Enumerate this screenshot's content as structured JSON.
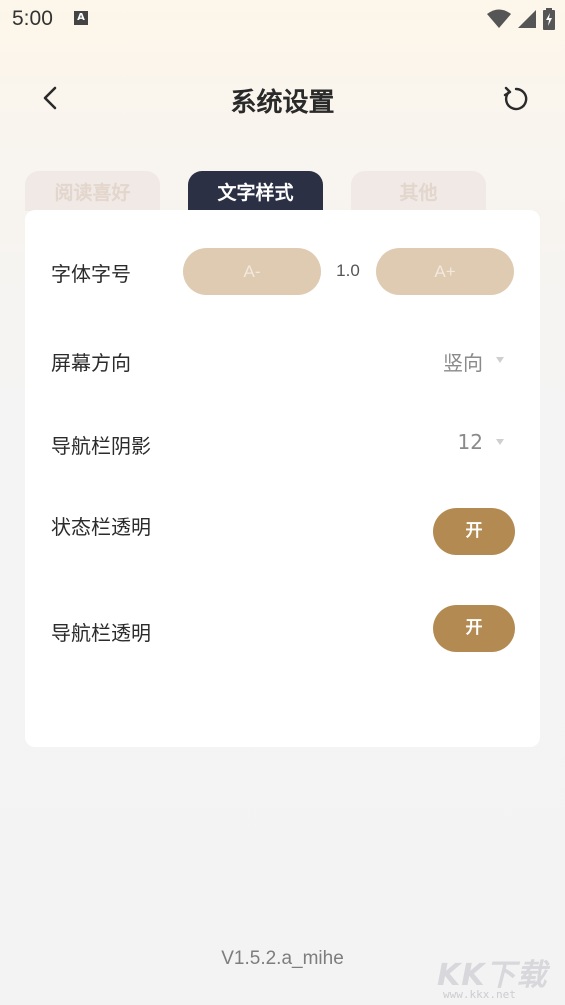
{
  "status_bar": {
    "time": "5:00",
    "notification_icon": "A"
  },
  "header": {
    "title": "系统设置",
    "back_icon": "chevron-left-icon",
    "reset_icon": "refresh-icon"
  },
  "tabs": [
    {
      "label": "阅读喜好",
      "active": false
    },
    {
      "label": "文字样式",
      "active": true
    },
    {
      "label": "其他",
      "active": false
    }
  ],
  "settings": {
    "font_size": {
      "label": "字体字号",
      "decrease_label": "A-",
      "value": "1.0",
      "increase_label": "A+"
    },
    "orientation": {
      "label": "屏幕方向",
      "value": "竖向"
    },
    "nav_shadow": {
      "label": "导航栏阴影",
      "value": "12"
    },
    "status_bar_transparent": {
      "label": "状态栏透明",
      "toggle": "开"
    },
    "nav_bar_transparent": {
      "label": "导航栏透明",
      "toggle": "开"
    }
  },
  "version": "V1.5.2.a_mihe",
  "watermark": {
    "text": "KK下载",
    "url": "www.kkx.net"
  },
  "colors": {
    "accent": "#b38a52",
    "pill": "#dfcbb1",
    "active_tab": "#2c3045",
    "inactive_tab": "#f0e9e5"
  }
}
